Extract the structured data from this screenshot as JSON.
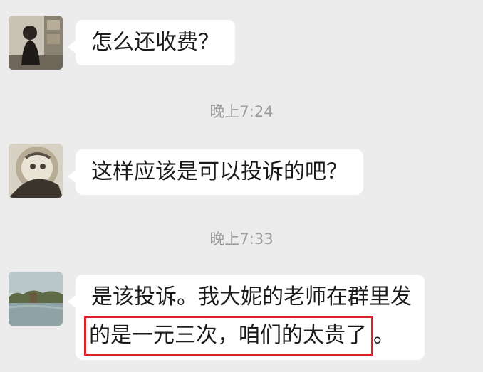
{
  "messages": [
    {
      "type": "text",
      "sender": "user1",
      "lines": [
        "怎么还收费？"
      ]
    },
    {
      "type": "time",
      "text": "晚上7:24"
    },
    {
      "type": "text",
      "sender": "user2",
      "lines": [
        "这样应该是可以投诉的吧？"
      ]
    },
    {
      "type": "time",
      "text": "晚上7:33"
    },
    {
      "type": "text",
      "sender": "user3",
      "lines": [
        "是该投诉。我大妮的老师在群里发"
      ],
      "highlighted": "的是一元三次，咱们的太贵了",
      "trailing": "。"
    }
  ],
  "colors": {
    "background": "#ececec",
    "bubble": "#ffffff",
    "highlight_border": "#e0202a",
    "timestamp": "#9d9d9d"
  }
}
